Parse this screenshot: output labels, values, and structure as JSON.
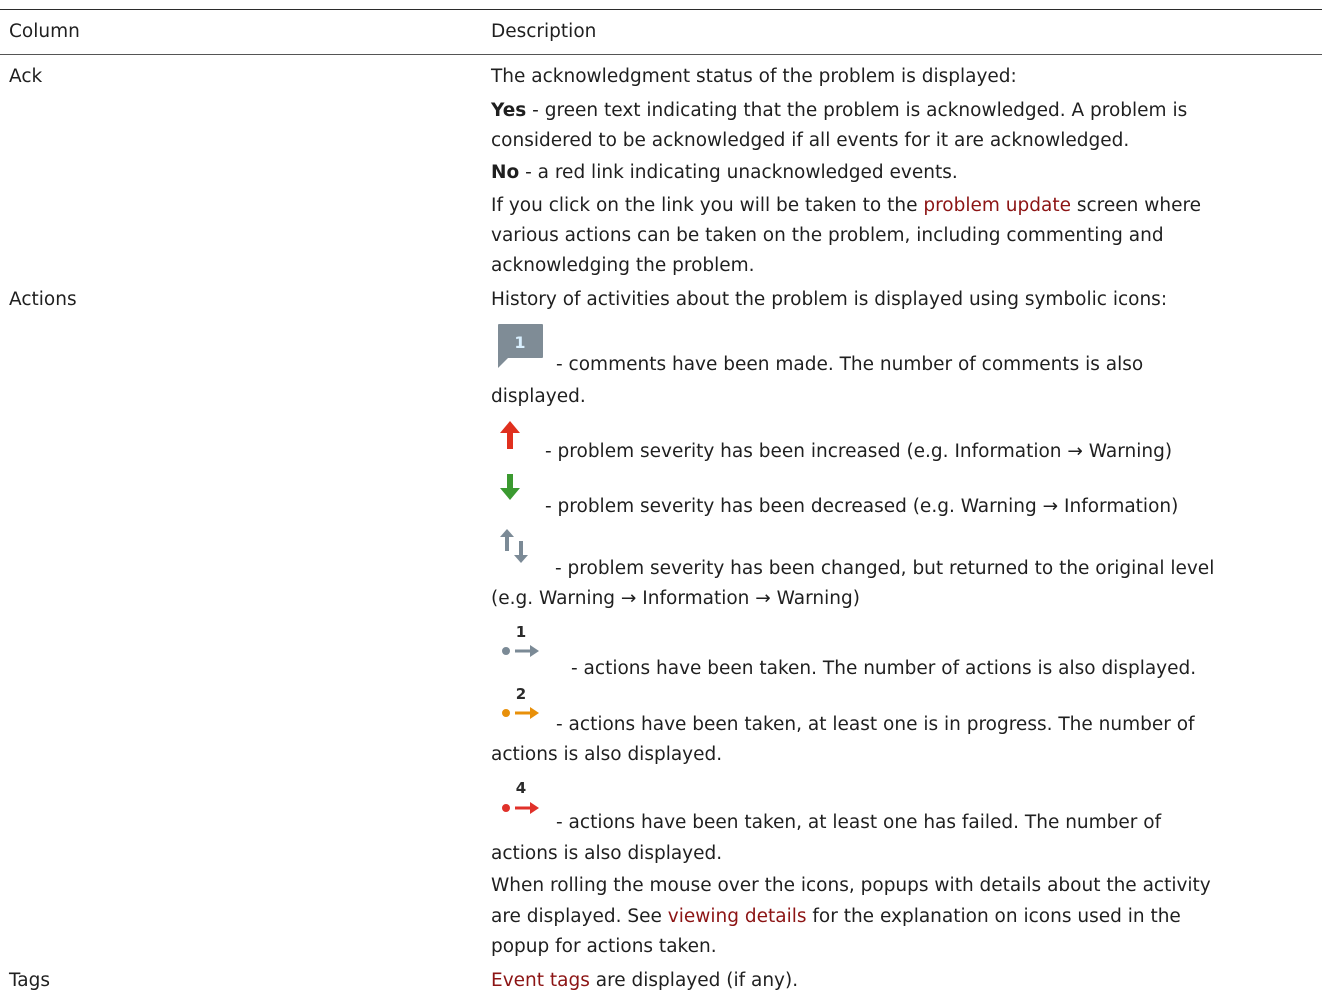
{
  "header": {
    "column": "Column",
    "description": "Description"
  },
  "rows": {
    "ack": {
      "name": "Ack",
      "intro": "The acknowledgment status of the problem is displayed:",
      "yes_label": "Yes",
      "yes_text_1": " - green text indicating that the problem is acknowledged. A problem is",
      "yes_text_2": "considered to be acknowledged if all events for it are acknowledged.",
      "no_label": "No",
      "no_text": " - a red link indicating unacknowledged events.",
      "link_pre": "If you click on the link you will be taken to the ",
      "link_text": "problem update",
      "link_post": " screen where",
      "line_b": "various actions can be taken on the problem, including commenting and",
      "line_c": "acknowledging the problem."
    },
    "actions": {
      "name": "Actions",
      "intro": "History of activities about the problem is displayed using symbolic icons:",
      "comments_1": "- comments have been made. The number of comments is also",
      "comments_2": "displayed.",
      "comments_count": "1",
      "sev_up": "- problem severity has been increased (e.g. Information → Warning)",
      "sev_down": "- problem severity has been decreased (e.g. Warning → Information)",
      "sev_changed_1": "- problem severity has been changed, but returned to the original level",
      "sev_changed_2": "(e.g. Warning → Information → Warning)",
      "taken_count": "1",
      "taken": "- actions have been taken. The number of actions is also displayed.",
      "progress_count": "2",
      "progress_1": "- actions have been taken, at least one is in progress. The number of",
      "progress_2": "actions is also displayed.",
      "failed_count": "4",
      "failed_1": "- actions have been taken, at least one has failed. The number of",
      "failed_2": "actions is also displayed.",
      "rollover_1": "When rolling the mouse over the icons, popups with details about the activity",
      "see_pre": "are displayed. See ",
      "see_link": "viewing details",
      "see_post": " for the explanation on icons used in the",
      "rollover_3": "popup for actions taken."
    },
    "tags": {
      "name": "Tags",
      "link": "Event tags",
      "text": " are displayed (if any)."
    }
  },
  "colors": {
    "link": "#8c1414",
    "comment_icon": "#7f8c96",
    "up_arrow": "#e0301e",
    "down_arrow": "#3b9a30",
    "neutral_icon": "#7b8a96",
    "progress": "#e8900a",
    "failed": "#e0312a"
  }
}
